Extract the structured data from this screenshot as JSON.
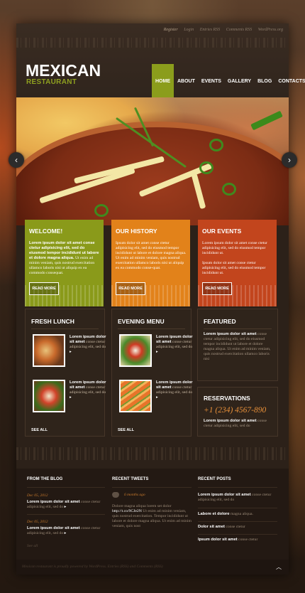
{
  "colors": {
    "accent_green": "#8b9d1c",
    "box_green": "#8a9a1a",
    "box_orange": "#e2821a",
    "box_red": "#c2451d",
    "phone_orange": "#e8903a",
    "date_orange": "#c97b2d"
  },
  "top_links": [
    "Register",
    "Login",
    "Entries RSS",
    "Comments RSS",
    "WordPress.org"
  ],
  "logo": {
    "title": "MEXICAN",
    "subtitle": "RESTAURANT"
  },
  "nav": [
    {
      "label": "HOME",
      "active": true
    },
    {
      "label": "ABOUT"
    },
    {
      "label": "EVENTS"
    },
    {
      "label": "GALLERY"
    },
    {
      "label": "BLOG"
    },
    {
      "label": "CONTACTS"
    }
  ],
  "slider": {
    "prev_icon": "chevron-left-icon",
    "next_icon": "chevron-right-icon"
  },
  "boxes": [
    {
      "title": "WELCOME!",
      "lead": "Lorem ipsum dolor sit amet conse ctetur adipisicing elit, sed do eiusmod tempor incididunt ut labore et dolore magna aliqua.",
      "body": "Ut enim ad minim veniam, quis nostrud exercitation ullamco laboris nisi ut aliquip ex ea commodo consequat.",
      "button": "READ MORE"
    },
    {
      "title": "OUR HISTORY",
      "lead": "Ipsum dolor sit amet conse ctetur adipisicing elit, sed do eiusmod tempor incididunt ut labore et dolore magna aliqua.",
      "body": "Ut enim ad minim veniam, quis nostrud exercitation ullamco laboris nisi ut aliquip ex ea commodo conse-quat.",
      "button": "READ MORE"
    },
    {
      "title": "OUR EVENTS",
      "lead": "Lorem ipsum dolor sit amet conse ctetur adipisicing elit, sed do eiusmod tempor incididunt ut.",
      "body": "Ipsum dolor sit amet conse ctetur adipisicing elit, sed do eiusmod tempor incididunt ut.",
      "button": "READ MORE"
    }
  ],
  "fresh_lunch": {
    "title": "FRESH LUNCH",
    "items": [
      {
        "bold": "Lorem ipsum dolor sit amet",
        "text": "conse ctetur adipisicing elit, sed do"
      },
      {
        "bold": "Lorem ipsum dolor sit amet",
        "text": "conse ctetur adipisicing elit, sed do"
      }
    ],
    "see_all": "SEE ALL"
  },
  "evening_menu": {
    "title": "EVENING MENU",
    "items": [
      {
        "bold": "Lorem ipsum dolor sit amet",
        "text": "conse ctetur adipisicing elit, sed do"
      },
      {
        "bold": "Lorem ipsum dolor sit amet",
        "text": "conse ctetur adipisicing elit, sed do"
      }
    ],
    "see_all": "SEE ALL"
  },
  "featured": {
    "title": "FEATURED",
    "bold": "Lorem ipsum dolor sit amet",
    "text": "conse ctetur adipisicing elit, sed do eiusmod tempor incididunt ut labore et dolore magna aliqua. Ut enim ad minim veniam, quis nostrud exercitation ullamco laboris nisi"
  },
  "reservations": {
    "title": "RESERVATIONS",
    "phone": "+1 (234) 4567-890",
    "bold": "Lorem ipsum dolor sit amet",
    "text": "conse ctetur adipisicing elit, sed do"
  },
  "footer": {
    "blog": {
      "title": "FROM THE BLOG",
      "posts": [
        {
          "date": "Dec 05, 2012",
          "bold": "Lorem ipsum dolor sit amet",
          "text": "conse ctetur adipisicing elit, sed do"
        },
        {
          "date": "Dec 05, 2012",
          "bold": "Lorem ipsum dolor sit amet",
          "text": "conse ctetur adipisicing elit, sed do"
        }
      ],
      "see_all": "See all"
    },
    "tweets": {
      "title": "RECENT TWEETS",
      "time": "6 months ago",
      "text1": "Dolore magna aliqua lorem set dolor",
      "link": "http://t.co/9CJe2N",
      "text2": "Ut enim ad minim veniam, quis nostrud exercitation. Tempor incididunt ut labore et dolore magna aliqua. Ut enim ad minim veniam, quis nost"
    },
    "recent_posts": {
      "title": "RECENT POSTS",
      "posts": [
        {
          "bold": "Lorem ipsum dolor sit amet",
          "text": "conse ctetur adipisicing elit, sed do"
        },
        {
          "bold": "Labore et dolore",
          "text": "magna aliqua."
        },
        {
          "bold": "Dolor sit amet",
          "text": "conse ctetur"
        },
        {
          "bold": "Ipsum dolor sit amet",
          "text": "conse ctetur"
        }
      ]
    },
    "copyright": "Mexican restaurant is proudly powered by WordPress. Entries (RSS) and Comments (RSS)",
    "up_icon": "chevron-up-icon"
  }
}
